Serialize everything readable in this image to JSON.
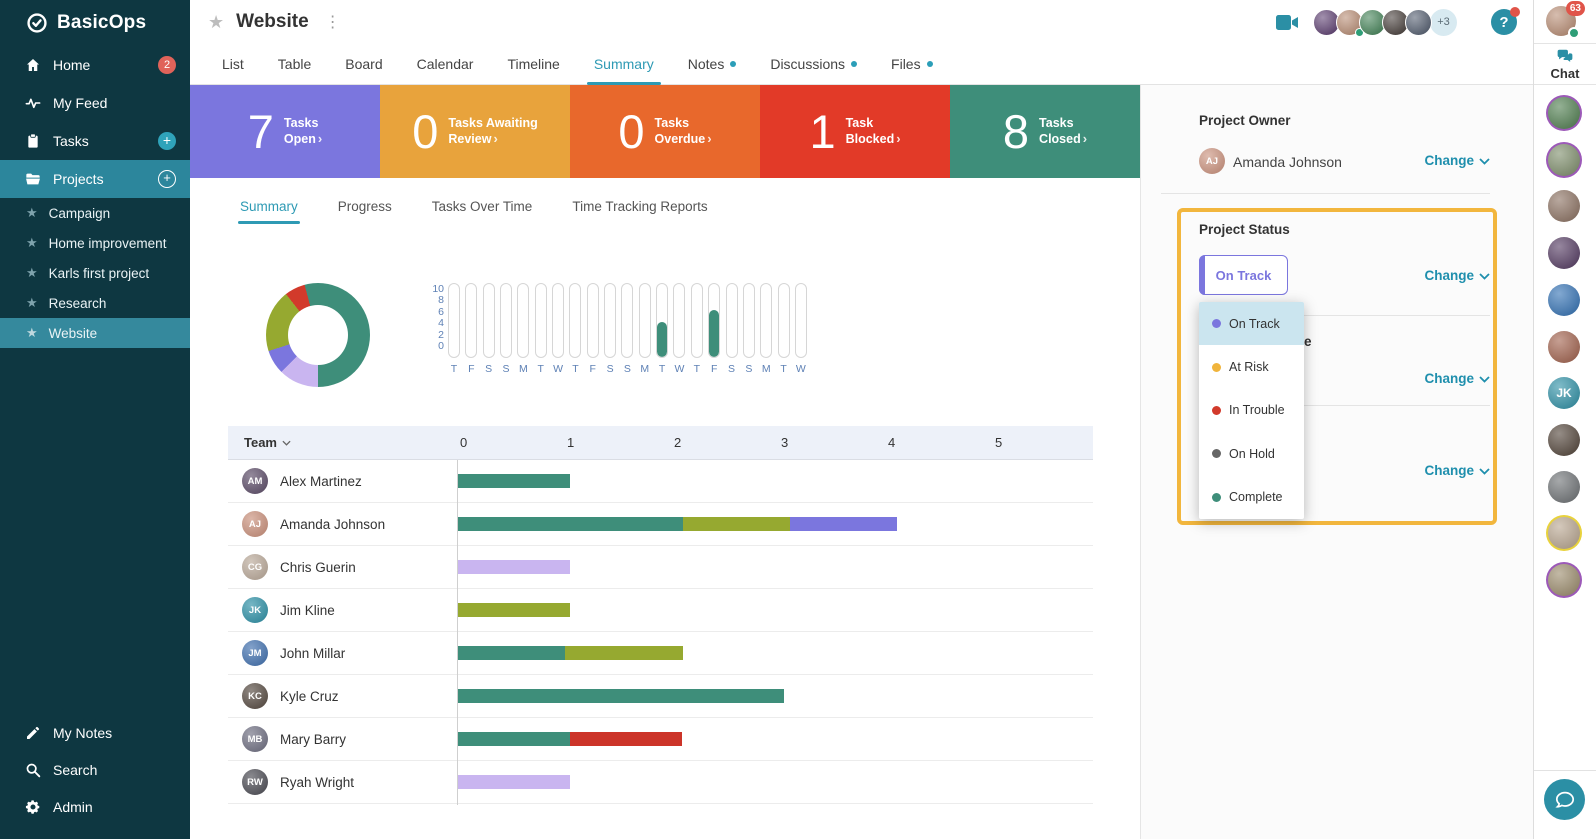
{
  "app": {
    "name": "BasicOps"
  },
  "colors": {
    "accent_teal": "#2B8FA5",
    "link_teal": "#1F8FAD",
    "active_tab_teal": "#2E9AB4",
    "sidebar_bg": "#0E3741",
    "sidebar_active": "#2C869C",
    "sidebar_selected": "#35899D",
    "stat_purple": "#7B76DE",
    "stat_amber": "#E8A33C",
    "stat_orange": "#E8682C",
    "stat_red": "#E23A28",
    "stat_teal": "#3E8E7A",
    "bar_teal": "#3E8E7A",
    "bar_olive": "#96A930",
    "bar_purple": "#7B76DE",
    "bar_lavender": "#C9B5F0",
    "bar_red": "#CC3429",
    "highlight_border": "#F2B63D",
    "dropdown_selected_bg": "#CBE5EF",
    "axis_text": "#5E81B5",
    "badge_red": "#E05449",
    "presence_green": "#2E9E77"
  },
  "sidebar": {
    "nav": [
      {
        "label": "Home",
        "icon": "home",
        "badge": "2"
      },
      {
        "label": "My Feed",
        "icon": "feed"
      },
      {
        "label": "Tasks",
        "icon": "tasks",
        "plus": "filled"
      },
      {
        "label": "Projects",
        "icon": "projects",
        "plus": "outline",
        "active": true
      }
    ],
    "projects": [
      {
        "label": "Campaign"
      },
      {
        "label": "Home improvement"
      },
      {
        "label": "Karls first project"
      },
      {
        "label": "Research"
      },
      {
        "label": "Website",
        "selected": true
      }
    ],
    "footer": [
      {
        "label": "My Notes",
        "icon": "pencil"
      },
      {
        "label": "Search",
        "icon": "search"
      },
      {
        "label": "Admin",
        "icon": "gear"
      }
    ]
  },
  "header": {
    "title": "Website",
    "overflow_count": "+3",
    "help_label": "?",
    "user_unread_badge": "63"
  },
  "header_avatars": [
    {
      "color": "#55356A"
    },
    {
      "color": "#B5876D",
      "status": true
    },
    {
      "color": "#3A7D4F"
    },
    {
      "color": "#3D3430"
    },
    {
      "color": "#4A5568"
    }
  ],
  "tabs": [
    {
      "label": "List"
    },
    {
      "label": "Table"
    },
    {
      "label": "Board"
    },
    {
      "label": "Calendar"
    },
    {
      "label": "Timeline"
    },
    {
      "label": "Summary",
      "active": true
    },
    {
      "label": "Notes",
      "dot": true
    },
    {
      "label": "Discussions",
      "dot": true
    },
    {
      "label": "Files",
      "dot": true
    }
  ],
  "stats": [
    {
      "value": "7",
      "label_line1": "Tasks",
      "label_line2": "Open",
      "color": "#7B76DE"
    },
    {
      "value": "0",
      "label_line1": "Tasks Awaiting",
      "label_line2": "Review",
      "color": "#E8A33C"
    },
    {
      "value": "0",
      "label_line1": "Tasks",
      "label_line2": "Overdue",
      "color": "#E8682C"
    },
    {
      "value": "1",
      "label_line1": "Task",
      "label_line2": "Blocked",
      "color": "#E23A28"
    },
    {
      "value": "8",
      "label_line1": "Tasks",
      "label_line2": "Closed",
      "color": "#3E8E7A"
    }
  ],
  "subtabs": [
    {
      "label": "Summary",
      "active": true
    },
    {
      "label": "Progress"
    },
    {
      "label": "Tasks Over Time"
    },
    {
      "label": "Time Tracking Reports"
    }
  ],
  "chart_data": [
    {
      "id": "task-status-donut",
      "type": "pie",
      "donut": true,
      "start_angle_deg": -15,
      "segments": [
        {
          "label": "Closed",
          "color": "#3E8E7A",
          "degrees": 195
        },
        {
          "label": "Open (lavender)",
          "color": "#C9B5F0",
          "degrees": 45
        },
        {
          "label": "Open (purple)",
          "color": "#7B76DE",
          "degrees": 27
        },
        {
          "label": "Open (olive)",
          "color": "#96A930",
          "degrees": 70
        },
        {
          "label": "Blocked",
          "color": "#D23A2B",
          "degrees": 23
        }
      ]
    },
    {
      "id": "tasks-over-time",
      "type": "bar",
      "ylim": [
        0,
        10
      ],
      "yticks": [
        10,
        8,
        6,
        4,
        2,
        0
      ],
      "categories": [
        "T",
        "F",
        "S",
        "S",
        "M",
        "T",
        "W",
        "T",
        "F",
        "S",
        "S",
        "M",
        "T",
        "W",
        "T",
        "F",
        "S",
        "S",
        "M",
        "T",
        "W"
      ],
      "values": [
        0,
        0,
        0,
        0,
        0,
        0,
        0,
        0,
        0,
        0,
        0,
        0,
        4,
        0,
        0,
        6,
        0,
        0,
        0,
        0,
        0
      ],
      "bar_color": "#3E8E7A"
    },
    {
      "id": "team-workload",
      "type": "bar",
      "orientation": "horizontal",
      "header": "Team",
      "xticks": [
        0,
        1,
        2,
        3,
        4,
        5
      ],
      "rows": [
        {
          "name": "Alex Martinez",
          "initials": "AM",
          "avatar_color": "#5A4A66",
          "segments": [
            {
              "color": "#3E8E7A",
              "value": 1.05
            }
          ]
        },
        {
          "name": "Amanda Johnson",
          "initials": "AJ",
          "avatar_color": "#C98F7A",
          "segments": [
            {
              "color": "#3E8E7A",
              "value": 2.1
            },
            {
              "color": "#96A930",
              "value": 1.0
            },
            {
              "color": "#7B76DE",
              "value": 1.0
            }
          ]
        },
        {
          "name": "Chris Guerin",
          "initials": "CG",
          "avatar_color": "#B9A898",
          "segments": [
            {
              "color": "#C9B5F0",
              "value": 1.05
            }
          ]
        },
        {
          "name": "Jim Kline",
          "initials": "JK",
          "avatar_color": "#2B8FA5",
          "segments": [
            {
              "color": "#96A930",
              "value": 1.05
            }
          ]
        },
        {
          "name": "John Millar",
          "initials": "JM",
          "avatar_color": "#3F6FAE",
          "segments": [
            {
              "color": "#3E8E7A",
              "value": 1.0
            },
            {
              "color": "#96A930",
              "value": 1.1
            }
          ]
        },
        {
          "name": "Kyle Cruz",
          "initials": "KC",
          "avatar_color": "#54483F",
          "segments": [
            {
              "color": "#3E8E7A",
              "value": 3.05
            }
          ]
        },
        {
          "name": "Mary Barry",
          "initials": "MB",
          "avatar_color": "#6D6D80",
          "segments": [
            {
              "color": "#3E8E7A",
              "value": 1.05
            },
            {
              "color": "#CC3429",
              "value": 1.05
            }
          ]
        },
        {
          "name": "Ryah Wright",
          "initials": "RW",
          "avatar_color": "#4A4A52",
          "segments": [
            {
              "color": "#C9B5F0",
              "value": 1.05
            }
          ]
        }
      ]
    }
  ],
  "info_panel": {
    "owner_heading": "Project Owner",
    "owner_name": "Amanda Johnson",
    "owner_initials": "AJ",
    "change_label": "Change",
    "status_heading": "Project Status",
    "status_value": "On Track",
    "obscured_text": "e"
  },
  "status_dropdown": {
    "options": [
      {
        "label": "On Track",
        "dot_color": "#7B76DE",
        "selected": true
      },
      {
        "label": "At Risk",
        "dot_color": "#F0B43C"
      },
      {
        "label": "In Trouble",
        "dot_color": "#D23A2B"
      },
      {
        "label": "On Hold",
        "dot_color": "#666666"
      },
      {
        "label": "Complete",
        "dot_color": "#3E8E7A"
      }
    ]
  },
  "chat": {
    "label": "Chat",
    "members": [
      {
        "ring": "#9C59B8",
        "color": "#4E7D4E"
      },
      {
        "ring": "#9C59B8",
        "color": "#7D8D6A"
      },
      {
        "ring": null,
        "color": "#8A6F5F"
      },
      {
        "ring": null,
        "color": "#51375F"
      },
      {
        "ring": null,
        "color": "#2F6FB3"
      },
      {
        "ring": null,
        "color": "#A05F4A"
      },
      {
        "ring": null,
        "color": "#2B8FA5",
        "initials": "JK"
      },
      {
        "ring": null,
        "color": "#4F4136"
      },
      {
        "ring": null,
        "color": "#6B6F72"
      },
      {
        "ring": "#E8D23C",
        "color": "#B8A58F"
      },
      {
        "ring": "#9C59B8",
        "color": "#9A8A6A"
      }
    ]
  }
}
